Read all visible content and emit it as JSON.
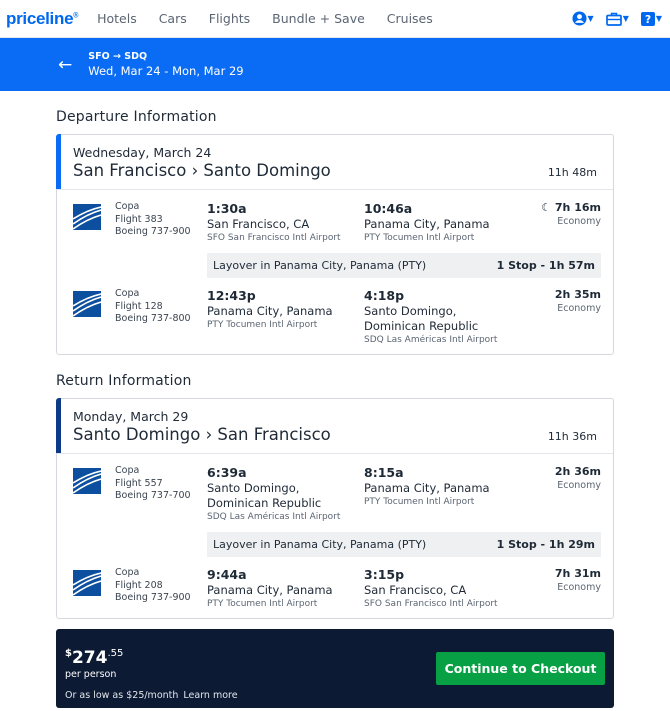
{
  "nav": {
    "logo": "priceline",
    "links": [
      "Hotels",
      "Cars",
      "Flights",
      "Bundle + Save",
      "Cruises"
    ]
  },
  "trip": {
    "route": "SFO → SDQ",
    "dates": "Wed, Mar 24 - Mon, Mar 29"
  },
  "departure": {
    "section_title": "Departure Information",
    "accent": "#0a6cf5",
    "date": "Wednesday, March 24",
    "route": "San Francisco › Santo Domingo",
    "duration": "11h 48m",
    "segments": [
      {
        "airline": "Copa",
        "flight": "Flight 383",
        "aircraft": "Boeing 737-900",
        "dep_time": "1:30a",
        "dep_city": "San Francisco, CA",
        "dep_airport": "SFO San Francisco Intl Airport",
        "arr_time": "10:46a",
        "arr_city": "Panama City, Panama",
        "arr_airport": "PTY Tocumen Intl Airport",
        "duration": "7h 16m",
        "cabin": "Economy",
        "overnight": true
      },
      {
        "airline": "Copa",
        "flight": "Flight 128",
        "aircraft": "Boeing 737-800",
        "dep_time": "12:43p",
        "dep_city": "Panama City, Panama",
        "dep_airport": "PTY Tocumen Intl Airport",
        "arr_time": "4:18p",
        "arr_city": "Santo Domingo, Dominican Republic",
        "arr_airport": "SDQ Las Américas Intl Airport",
        "duration": "2h 35m",
        "cabin": "Economy",
        "overnight": false
      }
    ],
    "layover": "Layover in Panama City, Panama (PTY)",
    "stops": "1 Stop - 1h 57m"
  },
  "return": {
    "section_title": "Return Information",
    "accent": "#0c3a86",
    "date": "Monday, March 29",
    "route": "Santo Domingo › San Francisco",
    "duration": "11h 36m",
    "segments": [
      {
        "airline": "Copa",
        "flight": "Flight 557",
        "aircraft": "Boeing 737-700",
        "dep_time": "6:39a",
        "dep_city": "Santo Domingo, Dominican Republic",
        "dep_airport": "SDQ Las Américas Intl Airport",
        "arr_time": "8:15a",
        "arr_city": "Panama City, Panama",
        "arr_airport": "PTY Tocumen Intl Airport",
        "duration": "2h 36m",
        "cabin": "Economy",
        "overnight": false
      },
      {
        "airline": "Copa",
        "flight": "Flight 208",
        "aircraft": "Boeing 737-900",
        "dep_time": "9:44a",
        "dep_city": "Panama City, Panama",
        "dep_airport": "PTY Tocumen Intl Airport",
        "arr_time": "3:15p",
        "arr_city": "San Francisco, CA",
        "arr_airport": "SFO San Francisco Intl Airport",
        "duration": "7h 31m",
        "cabin": "Economy",
        "overnight": false
      }
    ],
    "layover": "Layover in Panama City, Panama (PTY)",
    "stops": "1 Stop - 1h 29m"
  },
  "price": {
    "currency": "$",
    "dollars": "274",
    "cents": ".55",
    "per_person": "per person",
    "finance": "Or as low as $25/month",
    "learn_more": "Learn more",
    "checkout": "Continue to Checkout"
  },
  "colors": {
    "brand_blue": "#0068ef",
    "trip_bar": "#0a6cf5",
    "price_panel": "#0c1a33",
    "checkout_green": "#08a045"
  },
  "icons": [
    "user-icon",
    "briefcase-icon",
    "help-icon",
    "back-arrow-icon",
    "moon-icon",
    "copa-logo-icon"
  ]
}
